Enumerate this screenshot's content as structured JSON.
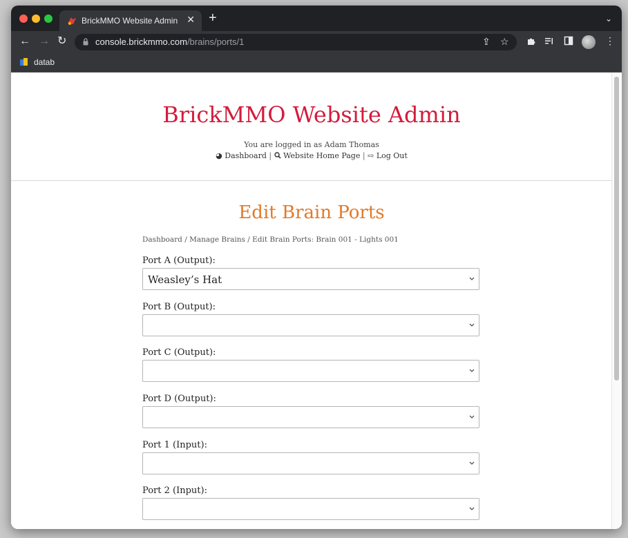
{
  "browser": {
    "tab_title": "BrickMMO Website Admin",
    "url_host": "console.brickmmo.com",
    "url_path": "/brains/ports/1",
    "bookmark_label": "datab"
  },
  "header": {
    "title": "BrickMMO Website Admin",
    "logged_in_text": "You are logged in as Adam Thomas",
    "links": {
      "dashboard": "Dashboard",
      "home": "Website Home Page",
      "logout": "Log Out",
      "separator": "|"
    }
  },
  "main": {
    "heading": "Edit Brain Ports",
    "breadcrumb": "Dashboard / Manage Brains / Edit Brain Ports: Brain 001 - Lights 001",
    "ports": [
      {
        "label": "Port A (Output):",
        "value": "Weasley’s Hat"
      },
      {
        "label": "Port B (Output):",
        "value": ""
      },
      {
        "label": "Port C (Output):",
        "value": ""
      },
      {
        "label": "Port D (Output):",
        "value": ""
      },
      {
        "label": "Port 1 (Input):",
        "value": ""
      },
      {
        "label": "Port 2 (Input):",
        "value": ""
      }
    ]
  },
  "colors": {
    "site_title": "#d21c3c",
    "page_heading": "#e07a2a"
  }
}
